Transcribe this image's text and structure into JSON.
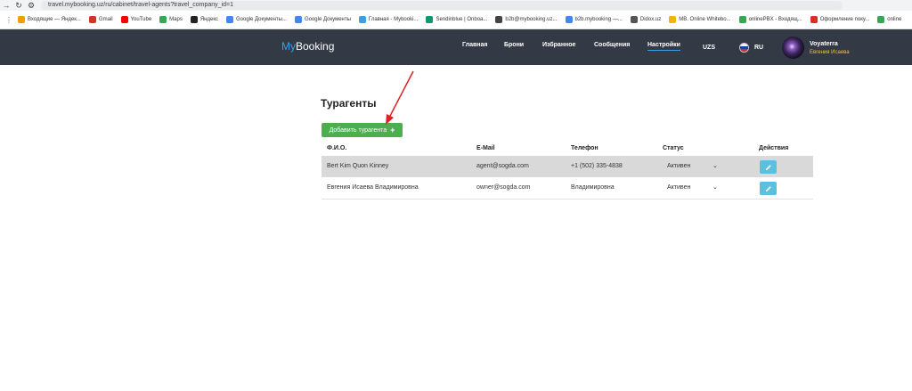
{
  "browser": {
    "url": "travel.mybooking.uz/ru/cabinet/travel-agents?travel_company_id=1",
    "bookmarks": [
      {
        "label": "Входящие — Яндек...",
        "color": "#f0a000"
      },
      {
        "label": "Gmail",
        "color": "#d93025"
      },
      {
        "label": "YouTube",
        "color": "#ff0000"
      },
      {
        "label": "Maps",
        "color": "#34a853"
      },
      {
        "label": "Яндекс",
        "color": "#222222"
      },
      {
        "label": "Google Документы...",
        "color": "#4285f4"
      },
      {
        "label": "Google Документы",
        "color": "#4285f4"
      },
      {
        "label": "Главная - Mybooki...",
        "color": "#3aa0e4"
      },
      {
        "label": "Sendinblue | Onboa...",
        "color": "#0b996e"
      },
      {
        "label": "b2b@mybooking.uz...",
        "color": "#444444"
      },
      {
        "label": "b2b.mybooking —...",
        "color": "#4285f4"
      },
      {
        "label": "Didox.uz",
        "color": "#555555"
      },
      {
        "label": "MB. Online Whitebo...",
        "color": "#f5b400"
      },
      {
        "label": "onlinePBX - Входящ...",
        "color": "#34a853"
      },
      {
        "label": "Оформление поку...",
        "color": "#d93025"
      },
      {
        "label": "online",
        "color": "#34a853"
      }
    ]
  },
  "header": {
    "logo_my": "My",
    "logo_rest": "Booking",
    "nav": [
      {
        "label": "Главная"
      },
      {
        "label": "Брони"
      },
      {
        "label": "Избранное"
      },
      {
        "label": "Сообщения"
      },
      {
        "label": "Настройки",
        "active": true
      }
    ],
    "currency": "UZS",
    "language": "RU",
    "user_name": "Voyaterra",
    "user_sub": "Евгения Исаева"
  },
  "main": {
    "title": "Турагенты",
    "add_button": "Добавить турагента",
    "columns": [
      "Ф.И.О.",
      "E-Mail",
      "Телефон",
      "Статус",
      "Действия"
    ],
    "rows": [
      {
        "name": "Bert Kim Quon Kinney",
        "email": "agent@sogda.com",
        "phone": "+1 (502) 335-4838",
        "status": "Активен"
      },
      {
        "name": "Евгения Исаева Владимировна",
        "email": "owner@sogda.com",
        "phone": "Владимировна",
        "status": "Активен"
      }
    ]
  },
  "colors": {
    "header_bg": "#343a45",
    "accent": "#3aa0e4",
    "success": "#4cae4c",
    "info": "#5bc0de",
    "annotation": "#e02020"
  }
}
